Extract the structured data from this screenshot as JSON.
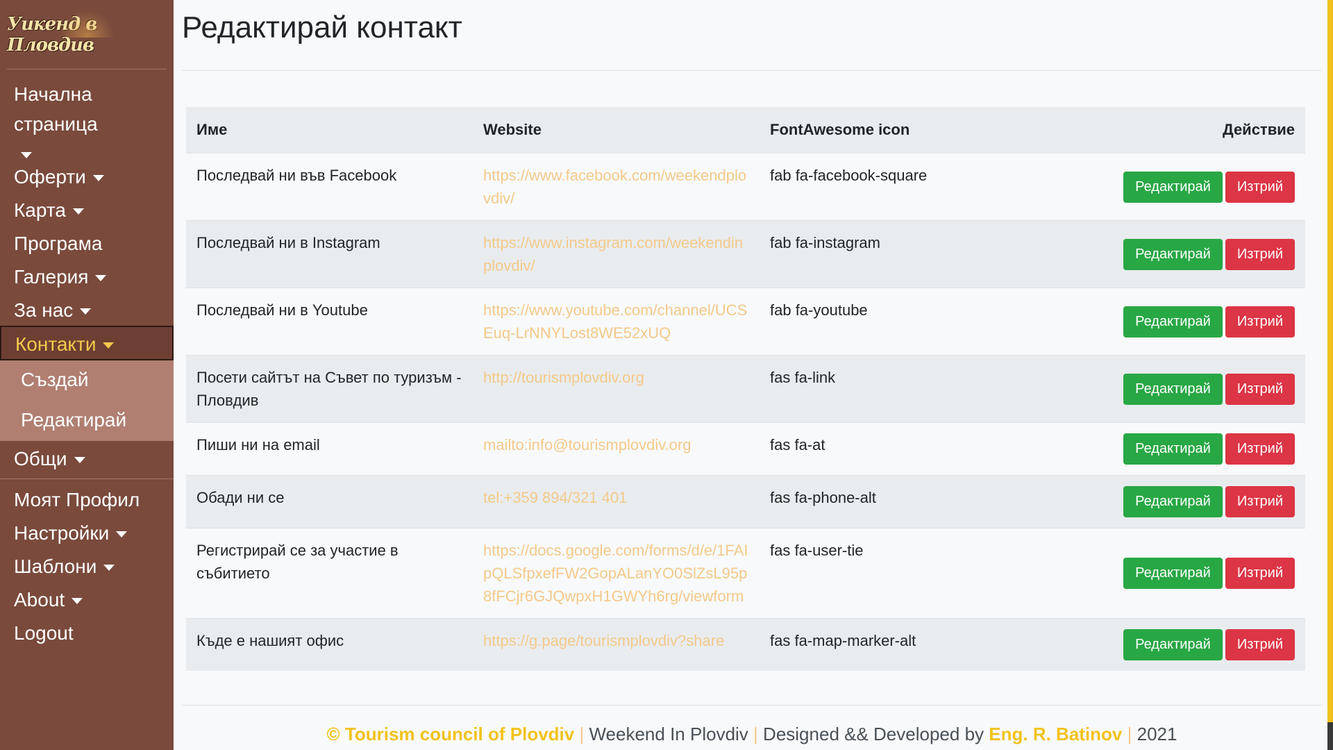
{
  "sidebar": {
    "logo_text": "Уикенд в Пловдив",
    "items": [
      {
        "label": "Начална страница",
        "caret": true
      },
      {
        "label": "Оферти",
        "caret": true
      },
      {
        "label": "Карта",
        "caret": true
      },
      {
        "label": "Програма",
        "caret": false
      },
      {
        "label": "Галерия",
        "caret": true
      },
      {
        "label": "За нас",
        "caret": true
      },
      {
        "label": "Контакти",
        "caret": true
      }
    ],
    "submenu": [
      {
        "label": "Създай"
      },
      {
        "label": "Редактирай"
      }
    ],
    "after_submenu": [
      {
        "label": "Общи",
        "caret": true
      }
    ],
    "bottom_items": [
      {
        "label": "Моят Профил",
        "caret": false
      },
      {
        "label": "Настройки",
        "caret": true
      },
      {
        "label": "Шаблони",
        "caret": true
      },
      {
        "label": "About",
        "caret": true
      },
      {
        "label": "Logout",
        "caret": false
      }
    ]
  },
  "main": {
    "title": "Редактирай контакт",
    "table": {
      "headers": {
        "name": "Име",
        "website": "Website",
        "icon": "FontAwesome icon",
        "action": "Действие"
      },
      "rows": [
        {
          "name": "Последвай ни във Facebook",
          "website": "https://www.facebook.com/weekendplovdiv/",
          "icon": "fab fa-facebook-square"
        },
        {
          "name": "Последвай ни в Instagram",
          "website": "https://www.instagram.com/weekendinplovdiv/",
          "icon": "fab fa-instagram"
        },
        {
          "name": "Последвай ни в Youtube",
          "website": "https://www.youtube.com/channel/UCSEuq-LrNNYLost8WE52xUQ",
          "icon": "fab fa-youtube"
        },
        {
          "name": "Посети сайтът на Съвет по туризъм - Пловдив",
          "website": "http://tourismplovdiv.org",
          "icon": "fas fa-link"
        },
        {
          "name": "Пиши ни на email",
          "website": "mailto:info@tourismplovdiv.org",
          "icon": "fas fa-at"
        },
        {
          "name": "Обади ни се",
          "website": "tel:+359 894/321 401",
          "icon": "fas fa-phone-alt"
        },
        {
          "name": "Регистрирай се за участие в събитието",
          "website": "https://docs.google.com/forms/d/e/1FAIpQLSfpxefFW2GopALanYO0SlZsL95p8fFCjr6GJQwpxH1GWYh6rg/viewform",
          "icon": "fas fa-user-tie"
        },
        {
          "name": "Къде е нашият офис",
          "website": "https://g.page/tourismplovdiv?share",
          "icon": "fas fa-map-marker-alt"
        }
      ],
      "edit_label": "Редактирай",
      "delete_label": "Изтрий"
    }
  },
  "footer": {
    "copyright": "© Tourism council of Plovdiv",
    "sep": "|",
    "site": "Weekend In Plovdiv",
    "credits_prefix": "Designed && Developed by",
    "author": "Eng. R. Batinov",
    "year": "2021"
  },
  "colors": {
    "sidebar_bg": "#7a4a3c",
    "active": "#f2c94c",
    "submenu_bg": "#b07f72",
    "link": "#f3c98a",
    "edit": "#28a745",
    "delete": "#dc3545"
  }
}
